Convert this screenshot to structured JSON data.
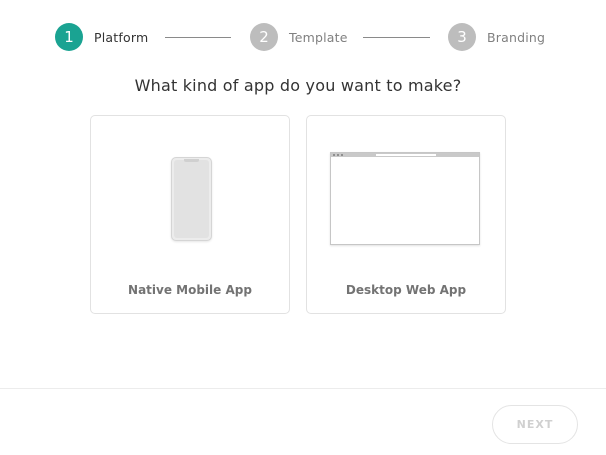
{
  "colors": {
    "accent": "#1aa392",
    "inactive_step": "#bdbdbd",
    "text_active": "#333333",
    "text_inactive": "#808080"
  },
  "stepper": {
    "steps": [
      {
        "number": "1",
        "label": "Platform",
        "state": "active"
      },
      {
        "number": "2",
        "label": "Template",
        "state": "inactive"
      },
      {
        "number": "3",
        "label": "Branding",
        "state": "inactive"
      }
    ]
  },
  "main": {
    "question": "What kind of app do you want to make?",
    "options": [
      {
        "label": "Native Mobile App",
        "icon": "phone-icon"
      },
      {
        "label": "Desktop Web App",
        "icon": "browser-window-icon"
      }
    ]
  },
  "footer": {
    "next_label": "NEXT",
    "next_state": "disabled"
  }
}
